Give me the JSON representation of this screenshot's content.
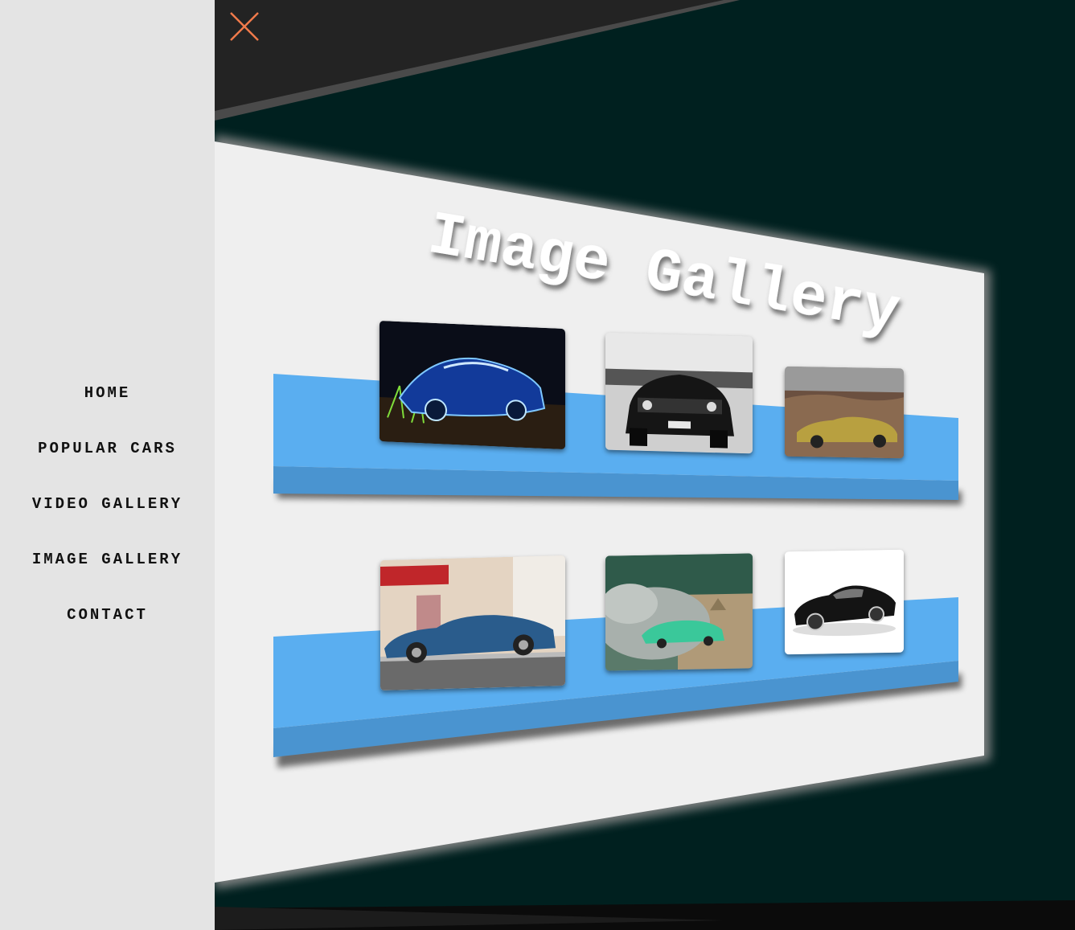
{
  "nav": {
    "items": [
      {
        "label": "HOME"
      },
      {
        "label": "POPULAR CARS"
      },
      {
        "label": "VIDEO GALLERY"
      },
      {
        "label": "IMAGE GALLERY"
      },
      {
        "label": "CONTACT"
      }
    ]
  },
  "page": {
    "title": "Image Gallery"
  },
  "gallery": {
    "rows": [
      {
        "images": [
          "neon-blue-mustang-photo",
          "black-white-camaro-photo",
          "gold-sedan-desert-photo"
        ]
      },
      {
        "images": [
          "blue-muscle-car-street-photo",
          "green-cadillac-smoke-photo",
          "black-sports-car-photo"
        ]
      }
    ]
  },
  "icons": {
    "close": "close-icon"
  },
  "colors": {
    "accent_close": "#f07a4a",
    "shelf_top": "#5aaef0",
    "shelf_front": "#4a94d0",
    "panel": "#efefef",
    "sidebar": "#e4e4e4",
    "stage": "#00201f"
  }
}
